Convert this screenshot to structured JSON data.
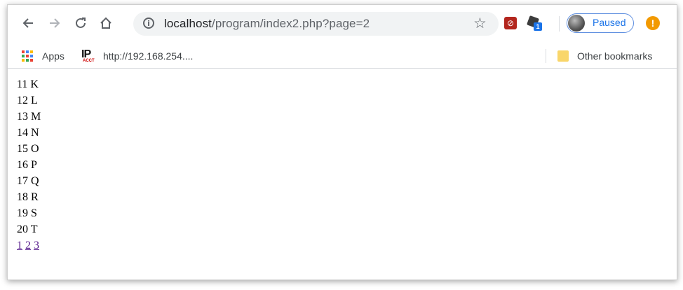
{
  "browser": {
    "url_host": "localhost",
    "url_path": "/program/index2.php?page=2",
    "profile_status": "Paused",
    "update_glyph": "!",
    "extension_badge": "1",
    "icons": {
      "back": "arrow-left-icon",
      "forward": "arrow-right-icon",
      "reload": "reload-icon",
      "home": "home-icon",
      "info": "info-icon",
      "star": "star-icon"
    }
  },
  "bookmarks": {
    "apps_label": "Apps",
    "ip_label": "http://192.168.254....",
    "ip_icon_text": "IP",
    "ip_icon_subtext": "ACCT",
    "other_label": "Other bookmarks"
  },
  "content": {
    "rows": [
      "11 K",
      "12 L",
      "13 M",
      "14 N",
      "15 O",
      "16 P",
      "17 Q",
      "18 R",
      "19 S",
      "20 T"
    ],
    "pages": [
      "1",
      "2",
      "3"
    ]
  },
  "colors": {
    "link_visited": "#551a8b",
    "profile_accent": "#1a73e8",
    "update_badge": "#f29900"
  }
}
